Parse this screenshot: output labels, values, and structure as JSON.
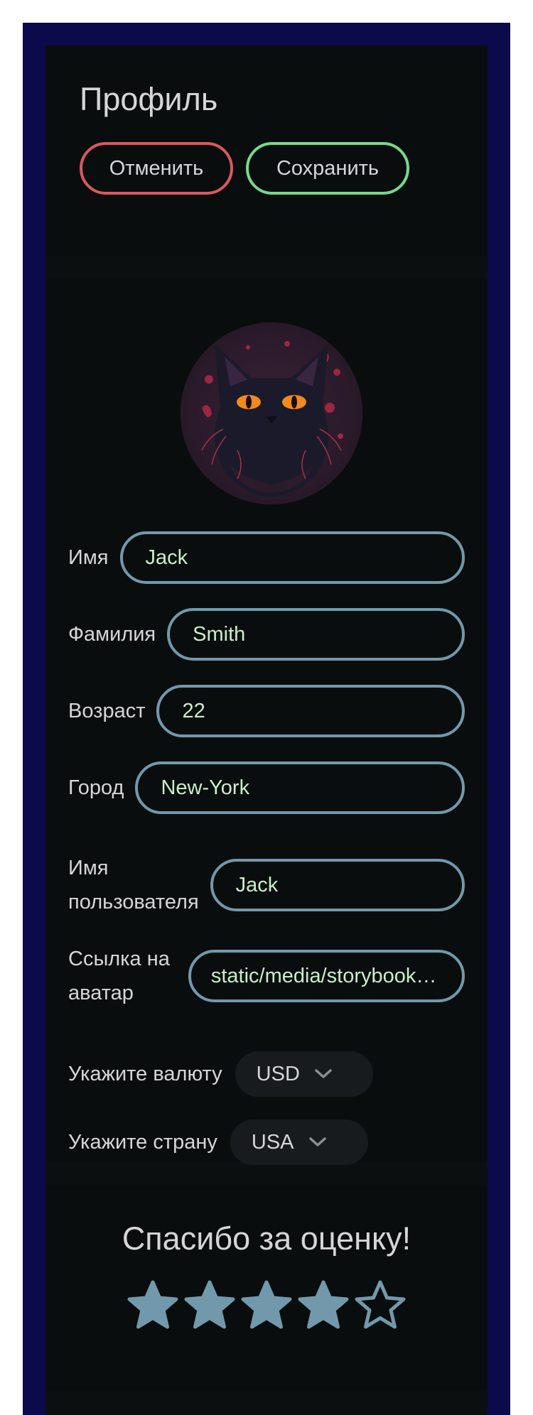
{
  "profile": {
    "title": "Профиль",
    "cancel_label": "Отменить",
    "save_label": "Сохранить"
  },
  "form": {
    "first_name": {
      "label": "Имя",
      "value": "Jack"
    },
    "last_name": {
      "label": "Фамилия",
      "value": "Smith"
    },
    "age": {
      "label": "Возраст",
      "value": "22"
    },
    "city": {
      "label": "Город",
      "value": "New-York"
    },
    "username": {
      "label_line1": "Имя",
      "label_line2": "пользователя",
      "value": "Jack"
    },
    "avatar_link": {
      "label_line1": "Ссылка на",
      "label_line2": "аватар",
      "value": "static/media/storybook/avatar.jpg"
    },
    "currency": {
      "label": "Укажите валюту",
      "value": "USD"
    },
    "country": {
      "label": "Укажите страну",
      "value": "USA"
    }
  },
  "rating": {
    "title": "Спасибо за оценку!",
    "value": 4,
    "max": 5
  },
  "colors": {
    "frame": "#0b0a4a",
    "cancel_border": "#d9595d",
    "save_border": "#7bd68f",
    "input_border": "#7299ab",
    "input_text": "#c8eec8",
    "star": "#7299ab"
  },
  "icons": {
    "select_chevron": "chevron-down-icon",
    "star": "star-icon"
  }
}
